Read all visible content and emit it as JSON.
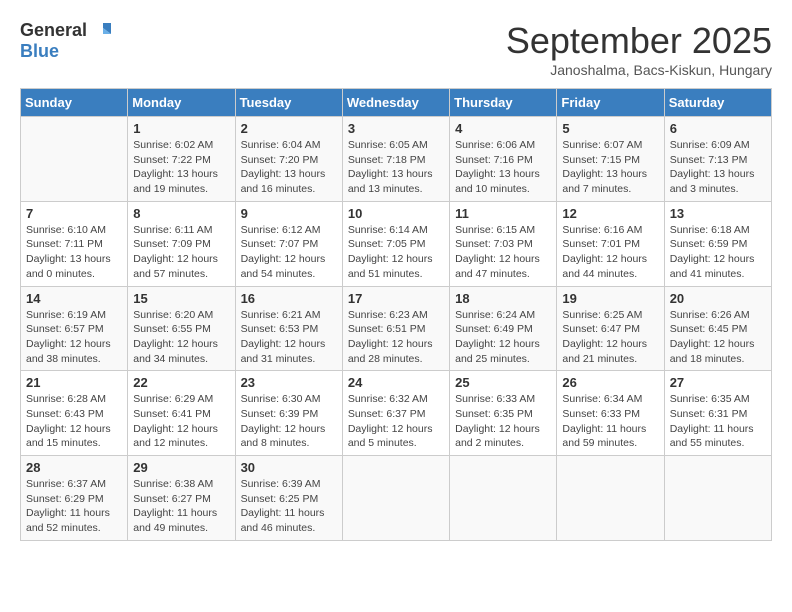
{
  "header": {
    "logo_general": "General",
    "logo_blue": "Blue",
    "month_title": "September 2025",
    "location": "Janoshalma, Bacs-Kiskun, Hungary"
  },
  "days_of_week": [
    "Sunday",
    "Monday",
    "Tuesday",
    "Wednesday",
    "Thursday",
    "Friday",
    "Saturday"
  ],
  "weeks": [
    [
      {
        "day": "",
        "content": ""
      },
      {
        "day": "1",
        "content": "Sunrise: 6:02 AM\nSunset: 7:22 PM\nDaylight: 13 hours\nand 19 minutes."
      },
      {
        "day": "2",
        "content": "Sunrise: 6:04 AM\nSunset: 7:20 PM\nDaylight: 13 hours\nand 16 minutes."
      },
      {
        "day": "3",
        "content": "Sunrise: 6:05 AM\nSunset: 7:18 PM\nDaylight: 13 hours\nand 13 minutes."
      },
      {
        "day": "4",
        "content": "Sunrise: 6:06 AM\nSunset: 7:16 PM\nDaylight: 13 hours\nand 10 minutes."
      },
      {
        "day": "5",
        "content": "Sunrise: 6:07 AM\nSunset: 7:15 PM\nDaylight: 13 hours\nand 7 minutes."
      },
      {
        "day": "6",
        "content": "Sunrise: 6:09 AM\nSunset: 7:13 PM\nDaylight: 13 hours\nand 3 minutes."
      }
    ],
    [
      {
        "day": "7",
        "content": "Sunrise: 6:10 AM\nSunset: 7:11 PM\nDaylight: 13 hours\nand 0 minutes."
      },
      {
        "day": "8",
        "content": "Sunrise: 6:11 AM\nSunset: 7:09 PM\nDaylight: 12 hours\nand 57 minutes."
      },
      {
        "day": "9",
        "content": "Sunrise: 6:12 AM\nSunset: 7:07 PM\nDaylight: 12 hours\nand 54 minutes."
      },
      {
        "day": "10",
        "content": "Sunrise: 6:14 AM\nSunset: 7:05 PM\nDaylight: 12 hours\nand 51 minutes."
      },
      {
        "day": "11",
        "content": "Sunrise: 6:15 AM\nSunset: 7:03 PM\nDaylight: 12 hours\nand 47 minutes."
      },
      {
        "day": "12",
        "content": "Sunrise: 6:16 AM\nSunset: 7:01 PM\nDaylight: 12 hours\nand 44 minutes."
      },
      {
        "day": "13",
        "content": "Sunrise: 6:18 AM\nSunset: 6:59 PM\nDaylight: 12 hours\nand 41 minutes."
      }
    ],
    [
      {
        "day": "14",
        "content": "Sunrise: 6:19 AM\nSunset: 6:57 PM\nDaylight: 12 hours\nand 38 minutes."
      },
      {
        "day": "15",
        "content": "Sunrise: 6:20 AM\nSunset: 6:55 PM\nDaylight: 12 hours\nand 34 minutes."
      },
      {
        "day": "16",
        "content": "Sunrise: 6:21 AM\nSunset: 6:53 PM\nDaylight: 12 hours\nand 31 minutes."
      },
      {
        "day": "17",
        "content": "Sunrise: 6:23 AM\nSunset: 6:51 PM\nDaylight: 12 hours\nand 28 minutes."
      },
      {
        "day": "18",
        "content": "Sunrise: 6:24 AM\nSunset: 6:49 PM\nDaylight: 12 hours\nand 25 minutes."
      },
      {
        "day": "19",
        "content": "Sunrise: 6:25 AM\nSunset: 6:47 PM\nDaylight: 12 hours\nand 21 minutes."
      },
      {
        "day": "20",
        "content": "Sunrise: 6:26 AM\nSunset: 6:45 PM\nDaylight: 12 hours\nand 18 minutes."
      }
    ],
    [
      {
        "day": "21",
        "content": "Sunrise: 6:28 AM\nSunset: 6:43 PM\nDaylight: 12 hours\nand 15 minutes."
      },
      {
        "day": "22",
        "content": "Sunrise: 6:29 AM\nSunset: 6:41 PM\nDaylight: 12 hours\nand 12 minutes."
      },
      {
        "day": "23",
        "content": "Sunrise: 6:30 AM\nSunset: 6:39 PM\nDaylight: 12 hours\nand 8 minutes."
      },
      {
        "day": "24",
        "content": "Sunrise: 6:32 AM\nSunset: 6:37 PM\nDaylight: 12 hours\nand 5 minutes."
      },
      {
        "day": "25",
        "content": "Sunrise: 6:33 AM\nSunset: 6:35 PM\nDaylight: 12 hours\nand 2 minutes."
      },
      {
        "day": "26",
        "content": "Sunrise: 6:34 AM\nSunset: 6:33 PM\nDaylight: 11 hours\nand 59 minutes."
      },
      {
        "day": "27",
        "content": "Sunrise: 6:35 AM\nSunset: 6:31 PM\nDaylight: 11 hours\nand 55 minutes."
      }
    ],
    [
      {
        "day": "28",
        "content": "Sunrise: 6:37 AM\nSunset: 6:29 PM\nDaylight: 11 hours\nand 52 minutes."
      },
      {
        "day": "29",
        "content": "Sunrise: 6:38 AM\nSunset: 6:27 PM\nDaylight: 11 hours\nand 49 minutes."
      },
      {
        "day": "30",
        "content": "Sunrise: 6:39 AM\nSunset: 6:25 PM\nDaylight: 11 hours\nand 46 minutes."
      },
      {
        "day": "",
        "content": ""
      },
      {
        "day": "",
        "content": ""
      },
      {
        "day": "",
        "content": ""
      },
      {
        "day": "",
        "content": ""
      }
    ]
  ]
}
